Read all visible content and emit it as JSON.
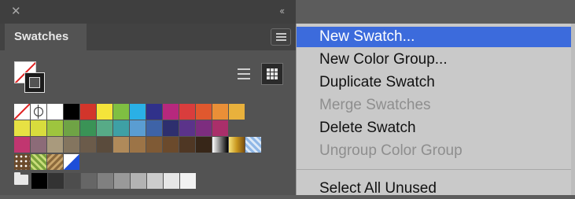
{
  "panel": {
    "close_icon": "close-icon",
    "collapse_icon": "double-chevron-icon",
    "tab_label": "Swatches",
    "panel_menu_icon": "hamburger-menu-icon",
    "fill_stroke_icon": "fill-stroke-indicator-icon",
    "view_buttons": [
      {
        "name": "list-view",
        "icon": "list-view-icon",
        "selected": false
      },
      {
        "name": "grid-view",
        "icon": "grid-view-icon",
        "selected": true
      }
    ],
    "swatch_rows": [
      [
        "none",
        "registration",
        "#ffffff",
        "#000000",
        "#d2352b",
        "#f4e43a",
        "#7fbf42",
        "#2ab0e6",
        "#30318a",
        "#b7287d",
        "#d93d3d",
        "#e0582e",
        "#ea8f37",
        "#e9b13c"
      ],
      [
        "#e7e143",
        "#d8dc3d",
        "#9ec53e",
        "#6fa345",
        "#3a9356",
        "#57ab87",
        "#3ea0a5",
        "#5a9dd2",
        "#3e63a7",
        "#2e2f6e",
        "#5b338a",
        "#7d2d7f",
        "#aa2f6a"
      ],
      [
        "#c13670",
        "#8c6b78",
        "#a99a7d",
        "#84755f",
        "#6b5b4a",
        "#5a4b3c",
        "#b08a5a",
        "#9c7447",
        "#7f5a35",
        "#6b4a2c",
        "#4f3724",
        "#372618",
        "gradient-bw",
        "gradient-gold",
        "pattern-blue"
      ],
      [
        "pattern-dots",
        "pattern-green",
        "pattern-brown",
        "#ffffff-blue"
      ],
      [
        "#000000",
        "#333333",
        "#4d4d4d",
        "#666666",
        "#808080",
        "#999999",
        "#b3b3b3",
        "#cccccc",
        "#e6e6e6",
        "#f2f2f2"
      ]
    ],
    "folder_icon": "folder-icon"
  },
  "menu": {
    "items": [
      {
        "label": "New Swatch...",
        "state": "highlighted"
      },
      {
        "label": "New Color Group...",
        "state": "enabled"
      },
      {
        "label": "Duplicate Swatch",
        "state": "enabled"
      },
      {
        "label": "Merge Swatches",
        "state": "disabled"
      },
      {
        "label": "Delete Swatch",
        "state": "enabled"
      },
      {
        "label": "Ungroup Color Group",
        "state": "disabled"
      },
      {
        "label": "Select All Unused",
        "state": "enabled"
      }
    ]
  }
}
